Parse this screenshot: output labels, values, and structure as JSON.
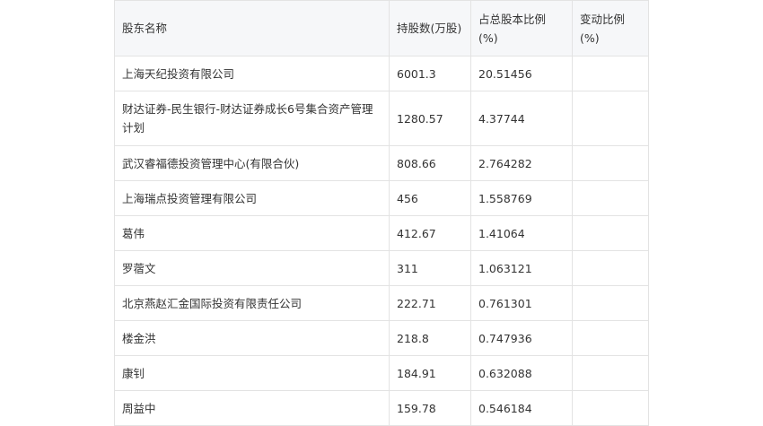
{
  "table": {
    "headers": [
      "股东名称",
      "持股数(万股)",
      "占总股本比例(%)",
      "变动比例(%)"
    ],
    "rows": [
      [
        "上海天纪投资有限公司",
        "6001.3",
        "20.51456",
        ""
      ],
      [
        "财达证券-民生银行-财达证券成长6号集合资产管理计划",
        "1280.57",
        "4.37744",
        ""
      ],
      [
        "武汉睿福德投资管理中心(有限合伙)",
        "808.66",
        "2.764282",
        ""
      ],
      [
        "上海瑞点投资管理有限公司",
        "456",
        "1.558769",
        ""
      ],
      [
        "葛伟",
        "412.67",
        "1.41064",
        ""
      ],
      [
        "罗蓿文",
        "311",
        "1.063121",
        ""
      ],
      [
        "北京燕赵汇金国际投资有限责任公司",
        "222.71",
        "0.761301",
        ""
      ],
      [
        "楼金洪",
        "218.8",
        "0.747936",
        ""
      ],
      [
        "康钊",
        "184.91",
        "0.632088",
        ""
      ],
      [
        "周益中",
        "159.78",
        "0.546184",
        ""
      ]
    ]
  }
}
